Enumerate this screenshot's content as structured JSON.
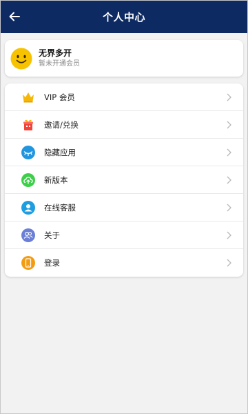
{
  "header": {
    "title": "个人中心",
    "background": "#0d2a62",
    "back_icon": "arrow-left-icon"
  },
  "profile": {
    "name": "无界多开",
    "status": "暂未开通会员",
    "avatar_icon": "smiley-face-icon",
    "avatar_color": "#f7c200"
  },
  "menu": [
    {
      "label": "VIP 会员",
      "icon": "crown-icon",
      "color": "#f5b80a"
    },
    {
      "label": "邀请/兑换",
      "icon": "gift-icon",
      "color": "#f0443a"
    },
    {
      "label": "隐藏应用",
      "icon": "closed-eye-icon",
      "color": "#2196e0"
    },
    {
      "label": "新版本",
      "icon": "cloud-upload-icon",
      "color": "#3ecf4a"
    },
    {
      "label": "在线客服",
      "icon": "user-icon",
      "color": "#1e9de0"
    },
    {
      "label": "关于",
      "icon": "about-users-icon",
      "color": "#6b7fd6"
    },
    {
      "label": "登录",
      "icon": "phone-icon",
      "color": "#f39c12"
    }
  ]
}
